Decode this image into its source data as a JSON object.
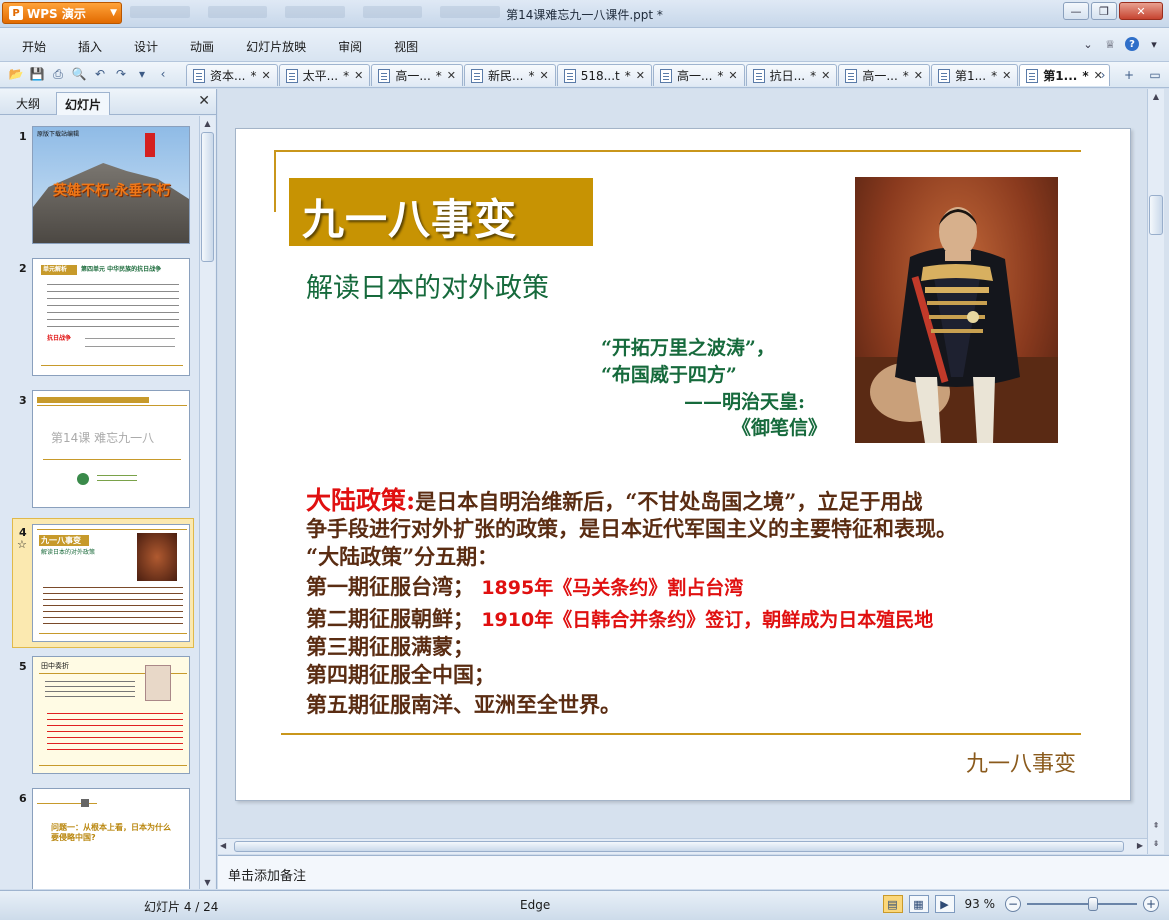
{
  "window": {
    "app_button": "WPS 演示",
    "title": "第14课难忘九一八课件.ppt *",
    "controls": {
      "minimize": "—",
      "restore": "❐",
      "close": "✕"
    }
  },
  "menu": {
    "items": [
      "开始",
      "插入",
      "设计",
      "动画",
      "幻灯片放映",
      "审阅",
      "视图"
    ]
  },
  "doc_tabs": [
    {
      "label": "资本...",
      "modified": "*"
    },
    {
      "label": "太平...",
      "modified": "*"
    },
    {
      "label": "高一...",
      "modified": "*"
    },
    {
      "label": "新民...",
      "modified": "*"
    },
    {
      "label": "518...t",
      "modified": "*"
    },
    {
      "label": "高一...",
      "modified": "*"
    },
    {
      "label": "抗日...",
      "modified": "*"
    },
    {
      "label": "高一...",
      "modified": "*"
    },
    {
      "label": "第1...",
      "modified": "*"
    },
    {
      "label": "第1...",
      "modified": "*",
      "active": true
    }
  ],
  "left_pane": {
    "tab_outline": "大纲",
    "tab_slides": "幻灯片",
    "close": "✕",
    "thumbnails": [
      {
        "num": "1",
        "caption": "英雄不朽·永垂不朽",
        "top_text": "原版下载站编辑"
      },
      {
        "num": "2",
        "header": "单元解析",
        "title": "第四单元  中华民族的抗日战争",
        "red": "抗日战争"
      },
      {
        "num": "3",
        "center": "第14课  难忘九一八"
      },
      {
        "num": "4",
        "title": "九一八事变",
        "sub": "解读日本的对外政策",
        "star": "☆"
      },
      {
        "num": "5",
        "title": "田中奏折"
      },
      {
        "num": "6",
        "question": "问题一：从根本上看，日本为什么要侵略中国?"
      }
    ]
  },
  "slide": {
    "title": "九一八事变",
    "subtitle": "解读日本的对外政策",
    "quote_line1": "“开拓万里之波涛”，",
    "quote_line2": "“布国威于四方”",
    "quote_author": "——明治天皇:",
    "quote_source": "《御笔信》",
    "policy_label": "大陆政策:",
    "policy_text1": "是日本自明治维新后，“不甘处岛国之境”，立足于用战",
    "policy_text2": "争手段进行对外扩张的政策，是日本近代军国主义的主要特征和表现。",
    "policy_text3": "“大陆政策”分五期：",
    "phase1": "第一期征服台湾；",
    "phase1_note": "1895年《马关条约》割占台湾",
    "phase2": "第二期征服朝鲜；",
    "phase2_note": "1910年《日韩合并条约》签订，朝鲜成为日本殖民地",
    "phase3": "第三期征服满蒙；",
    "phase4": "第四期征服全中国；",
    "phase5": "第五期征服南洋、亚洲至全世界。",
    "footer": "九一八事变"
  },
  "notes": {
    "placeholder": "单击添加备注"
  },
  "status": {
    "slide_indicator": "幻灯片 4 / 24",
    "theme": "Edge",
    "zoom": "93 %",
    "zoom_fraction": 0.6
  }
}
